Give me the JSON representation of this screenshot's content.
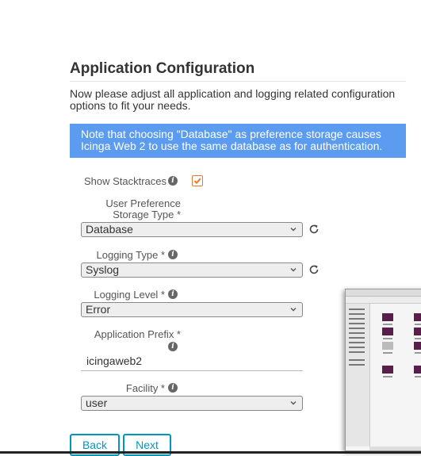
{
  "page": {
    "title": "Application Configuration",
    "intro": "Now please adjust all application and logging related configuration options to fit your needs.",
    "note": "Note that choosing \"Database\" as preference storage causes Icinga Web 2 to use the same database as for authentication."
  },
  "form": {
    "show_stacktraces": {
      "label": "Show Stacktraces",
      "checked": true
    },
    "user_preference_storage": {
      "label": "User Preference Storage Type *",
      "value": "Database"
    },
    "logging_type": {
      "label": "Logging Type *",
      "value": "Syslog"
    },
    "logging_level": {
      "label": "Logging Level *",
      "value": "Error"
    },
    "application_prefix": {
      "label": "Application Prefix *",
      "value": "icingaweb2"
    },
    "facility": {
      "label": "Facility *",
      "value": "user"
    }
  },
  "buttons": {
    "back": "Back",
    "next": "Next"
  },
  "icons": {
    "info": "info-icon",
    "refresh": "refresh-icon",
    "chevron": "chevron-down-icon",
    "check": "check-icon"
  },
  "colors": {
    "accent": "#0095bf",
    "note_bg": "#5c9cf0",
    "checkbox": "#e87a2d"
  }
}
